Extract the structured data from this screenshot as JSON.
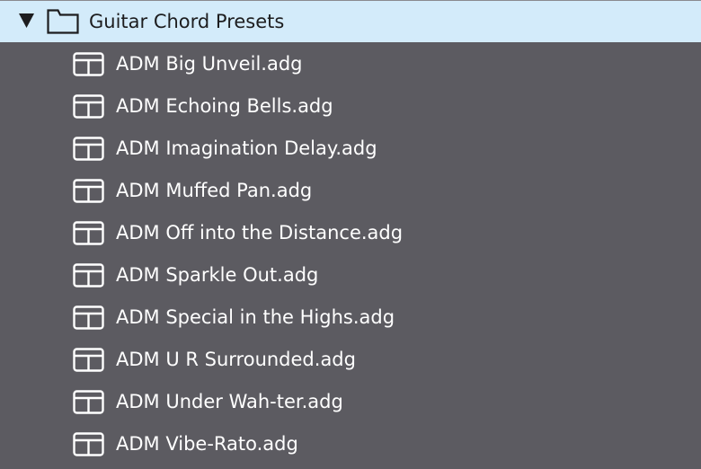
{
  "folder": {
    "label": "Guitar Chord Presets",
    "expanded": true,
    "disclosure_icon": "triangle-down-icon",
    "icon": "folder-icon"
  },
  "items": [
    {
      "label": "ADM Big Unveil.adg",
      "icon": "preset-icon"
    },
    {
      "label": "ADM Echoing Bells.adg",
      "icon": "preset-icon"
    },
    {
      "label": "ADM Imagination Delay.adg",
      "icon": "preset-icon"
    },
    {
      "label": "ADM Muffed Pan.adg",
      "icon": "preset-icon"
    },
    {
      "label": "ADM Off into the Distance.adg",
      "icon": "preset-icon"
    },
    {
      "label": "ADM Sparkle Out.adg",
      "icon": "preset-icon"
    },
    {
      "label": "ADM Special in the Highs.adg",
      "icon": "preset-icon"
    },
    {
      "label": "ADM U R Surrounded.adg",
      "icon": "preset-icon"
    },
    {
      "label": "ADM Under Wah-ter.adg",
      "icon": "preset-icon"
    },
    {
      "label": "ADM Vibe-Rato.adg",
      "icon": "preset-icon"
    }
  ],
  "colors": {
    "background": "#5c5b61",
    "selected_row": "#d3ebfa",
    "text_light": "#ffffff",
    "text_dark": "#1d1d1f"
  }
}
